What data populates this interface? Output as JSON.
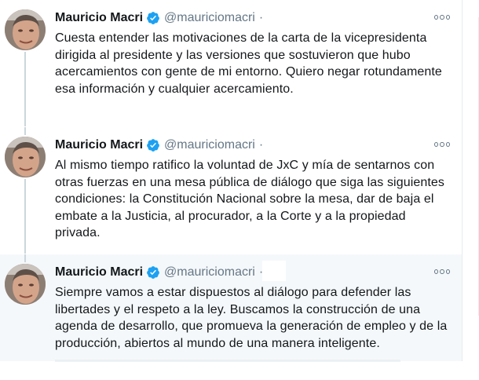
{
  "tweets": [
    {
      "author": "Mauricio Macri",
      "handle": "@mauriciomacri",
      "separator": "·",
      "text": "Cuesta entender las motivaciones de la carta de la vicepresidenta dirigida al presidente y las versiones que sostuvieron que hubo acercamientos con gente de mi entorno. Quiero negar rotundamente esa información y cualquier acercamiento."
    },
    {
      "author": "Mauricio Macri",
      "handle": "@mauriciomacri",
      "separator": "·",
      "text": "Al mismo tiempo ratifico la voluntad de JxC y mía de sentarnos con otras fuerzas en una mesa pública de diálogo que siga las siguientes condiciones: la Constitución Nacional sobre la mesa, dar de baja el embate a la Justicia, al procurador, a la Corte y a la propiedad privada."
    },
    {
      "author": "Mauricio Macri",
      "handle": "@mauriciomacri",
      "separator": "·",
      "text": "Siempre vamos a estar dispuestos al diálogo para defender las libertades y el respeto a la ley. Buscamos la construcción de una agenda de desarrollo, que promueva la generación de empleo y de la producción, abiertos al mundo de una manera inteligente."
    }
  ],
  "icons": {
    "verified": "verified-badge-icon",
    "more": "more-options-icon"
  },
  "colors": {
    "verified": "#1da1f2",
    "name": "#14171a",
    "secondary": "#657786",
    "thread_line": "#ccd6dd",
    "highlight_bg": "#f5f8fa"
  }
}
